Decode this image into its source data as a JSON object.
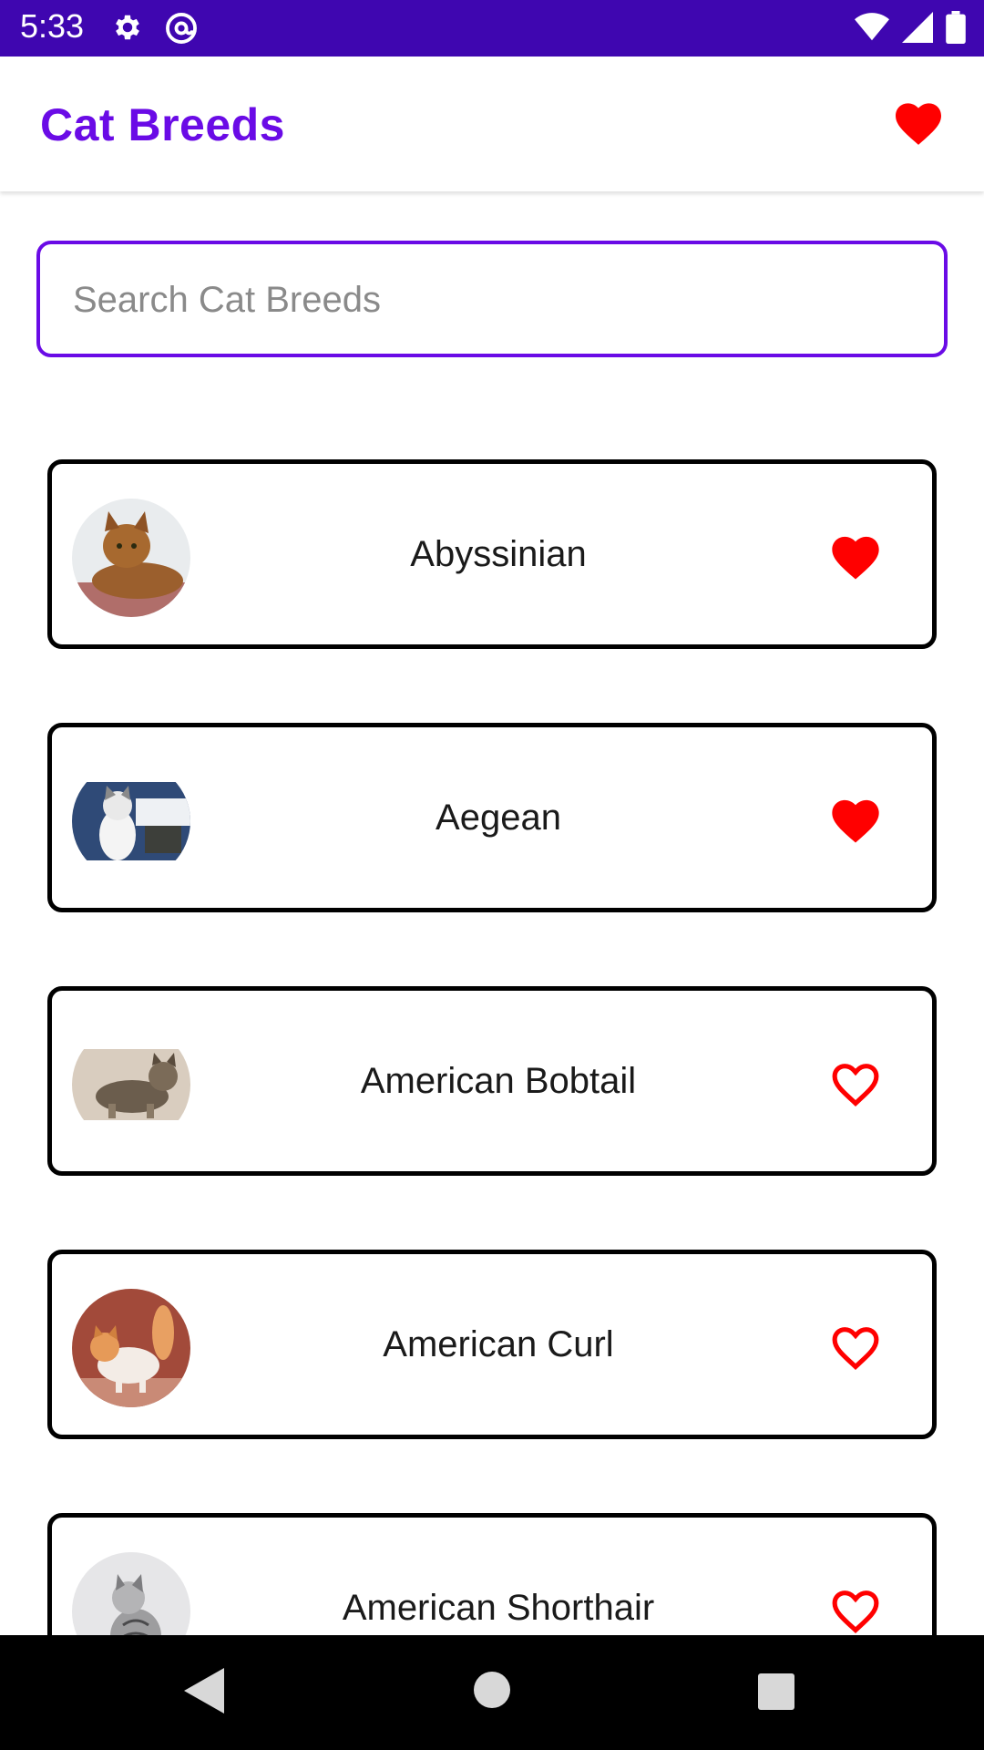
{
  "status_bar": {
    "time": "5:33",
    "icons": [
      "gear-icon",
      "at-sign-icon",
      "wifi-icon",
      "signal-icon",
      "battery-icon"
    ]
  },
  "app_bar": {
    "title": "Cat Breeds",
    "favorites_icon": "heart-icon",
    "title_color": "#6a0be6"
  },
  "search": {
    "placeholder": "Search Cat Breeds",
    "value": ""
  },
  "breeds": [
    {
      "name": "Abyssinian",
      "favorite": true
    },
    {
      "name": "Aegean",
      "favorite": true
    },
    {
      "name": "American Bobtail",
      "favorite": false
    },
    {
      "name": "American Curl",
      "favorite": false
    },
    {
      "name": "American Shorthair",
      "favorite": false
    }
  ],
  "colors": {
    "status_bar": "#3f06b0",
    "accent": "#6a0be6",
    "heart": "#ff0000"
  },
  "nav_bar": {
    "icons": [
      "back-triangle-icon",
      "home-circle-icon",
      "recents-square-icon"
    ]
  }
}
